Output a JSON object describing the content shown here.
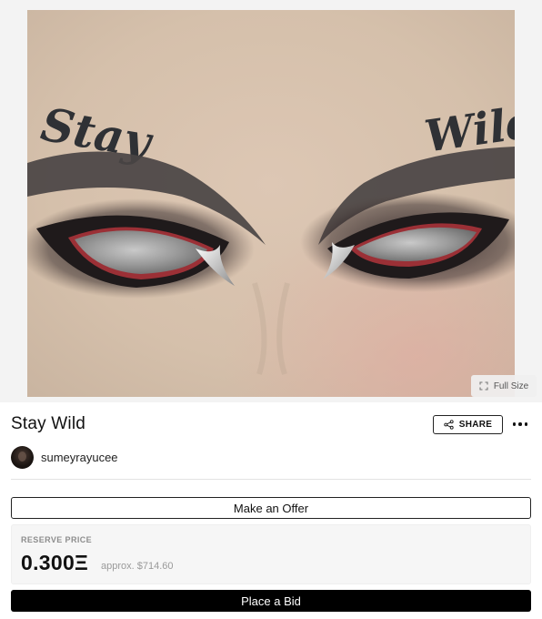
{
  "artwork": {
    "alt": "Stay Wild",
    "tattoo_left": "Stay",
    "tattoo_right": "Wild",
    "full_size_label": "Full Size",
    "full_size_icon": "expand-icon"
  },
  "item": {
    "title": "Stay Wild",
    "share_label": "SHARE",
    "share_icon": "share-icon",
    "more_icon": "more-horizontal-icon"
  },
  "creator": {
    "username": "sumeyrayucee"
  },
  "actions": {
    "make_offer_label": "Make an Offer",
    "place_bid_label": "Place a Bid"
  },
  "reserve": {
    "label": "RESERVE PRICE",
    "price": "0.300Ξ",
    "approx": "approx. $714.60"
  },
  "colors": {
    "canvas": "#d7c3b0",
    "button_dark": "#000000",
    "border": "#222222",
    "muted_text": "#8d8d8d"
  }
}
